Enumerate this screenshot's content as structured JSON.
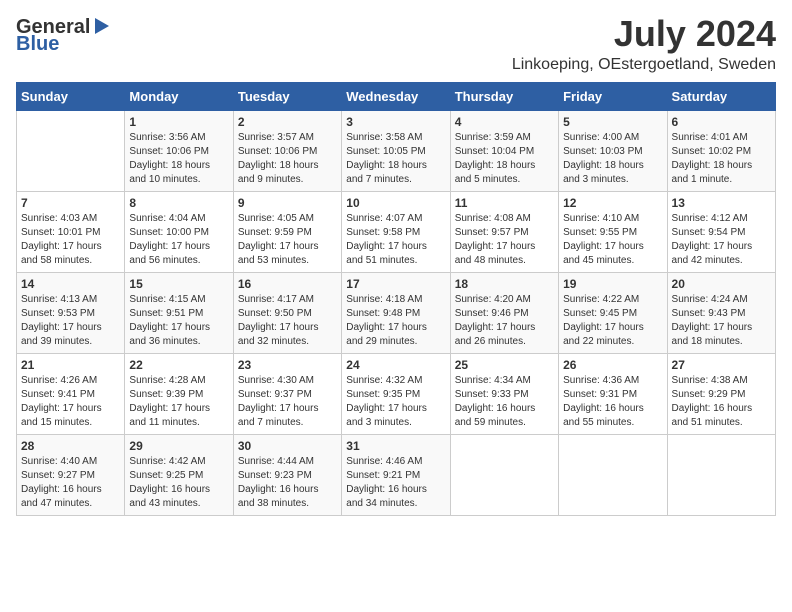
{
  "header": {
    "logo_general": "General",
    "logo_blue": "Blue",
    "month_year": "July 2024",
    "location": "Linkoeping, OEstergoetland, Sweden"
  },
  "days_of_week": [
    "Sunday",
    "Monday",
    "Tuesday",
    "Wednesday",
    "Thursday",
    "Friday",
    "Saturday"
  ],
  "weeks": [
    [
      {
        "day": "",
        "sunrise": "",
        "sunset": "",
        "daylight": ""
      },
      {
        "day": "1",
        "sunrise": "Sunrise: 3:56 AM",
        "sunset": "Sunset: 10:06 PM",
        "daylight": "Daylight: 18 hours and 10 minutes."
      },
      {
        "day": "2",
        "sunrise": "Sunrise: 3:57 AM",
        "sunset": "Sunset: 10:06 PM",
        "daylight": "Daylight: 18 hours and 9 minutes."
      },
      {
        "day": "3",
        "sunrise": "Sunrise: 3:58 AM",
        "sunset": "Sunset: 10:05 PM",
        "daylight": "Daylight: 18 hours and 7 minutes."
      },
      {
        "day": "4",
        "sunrise": "Sunrise: 3:59 AM",
        "sunset": "Sunset: 10:04 PM",
        "daylight": "Daylight: 18 hours and 5 minutes."
      },
      {
        "day": "5",
        "sunrise": "Sunrise: 4:00 AM",
        "sunset": "Sunset: 10:03 PM",
        "daylight": "Daylight: 18 hours and 3 minutes."
      },
      {
        "day": "6",
        "sunrise": "Sunrise: 4:01 AM",
        "sunset": "Sunset: 10:02 PM",
        "daylight": "Daylight: 18 hours and 1 minute."
      }
    ],
    [
      {
        "day": "7",
        "sunrise": "Sunrise: 4:03 AM",
        "sunset": "Sunset: 10:01 PM",
        "daylight": "Daylight: 17 hours and 58 minutes."
      },
      {
        "day": "8",
        "sunrise": "Sunrise: 4:04 AM",
        "sunset": "Sunset: 10:00 PM",
        "daylight": "Daylight: 17 hours and 56 minutes."
      },
      {
        "day": "9",
        "sunrise": "Sunrise: 4:05 AM",
        "sunset": "Sunset: 9:59 PM",
        "daylight": "Daylight: 17 hours and 53 minutes."
      },
      {
        "day": "10",
        "sunrise": "Sunrise: 4:07 AM",
        "sunset": "Sunset: 9:58 PM",
        "daylight": "Daylight: 17 hours and 51 minutes."
      },
      {
        "day": "11",
        "sunrise": "Sunrise: 4:08 AM",
        "sunset": "Sunset: 9:57 PM",
        "daylight": "Daylight: 17 hours and 48 minutes."
      },
      {
        "day": "12",
        "sunrise": "Sunrise: 4:10 AM",
        "sunset": "Sunset: 9:55 PM",
        "daylight": "Daylight: 17 hours and 45 minutes."
      },
      {
        "day": "13",
        "sunrise": "Sunrise: 4:12 AM",
        "sunset": "Sunset: 9:54 PM",
        "daylight": "Daylight: 17 hours and 42 minutes."
      }
    ],
    [
      {
        "day": "14",
        "sunrise": "Sunrise: 4:13 AM",
        "sunset": "Sunset: 9:53 PM",
        "daylight": "Daylight: 17 hours and 39 minutes."
      },
      {
        "day": "15",
        "sunrise": "Sunrise: 4:15 AM",
        "sunset": "Sunset: 9:51 PM",
        "daylight": "Daylight: 17 hours and 36 minutes."
      },
      {
        "day": "16",
        "sunrise": "Sunrise: 4:17 AM",
        "sunset": "Sunset: 9:50 PM",
        "daylight": "Daylight: 17 hours and 32 minutes."
      },
      {
        "day": "17",
        "sunrise": "Sunrise: 4:18 AM",
        "sunset": "Sunset: 9:48 PM",
        "daylight": "Daylight: 17 hours and 29 minutes."
      },
      {
        "day": "18",
        "sunrise": "Sunrise: 4:20 AM",
        "sunset": "Sunset: 9:46 PM",
        "daylight": "Daylight: 17 hours and 26 minutes."
      },
      {
        "day": "19",
        "sunrise": "Sunrise: 4:22 AM",
        "sunset": "Sunset: 9:45 PM",
        "daylight": "Daylight: 17 hours and 22 minutes."
      },
      {
        "day": "20",
        "sunrise": "Sunrise: 4:24 AM",
        "sunset": "Sunset: 9:43 PM",
        "daylight": "Daylight: 17 hours and 18 minutes."
      }
    ],
    [
      {
        "day": "21",
        "sunrise": "Sunrise: 4:26 AM",
        "sunset": "Sunset: 9:41 PM",
        "daylight": "Daylight: 17 hours and 15 minutes."
      },
      {
        "day": "22",
        "sunrise": "Sunrise: 4:28 AM",
        "sunset": "Sunset: 9:39 PM",
        "daylight": "Daylight: 17 hours and 11 minutes."
      },
      {
        "day": "23",
        "sunrise": "Sunrise: 4:30 AM",
        "sunset": "Sunset: 9:37 PM",
        "daylight": "Daylight: 17 hours and 7 minutes."
      },
      {
        "day": "24",
        "sunrise": "Sunrise: 4:32 AM",
        "sunset": "Sunset: 9:35 PM",
        "daylight": "Daylight: 17 hours and 3 minutes."
      },
      {
        "day": "25",
        "sunrise": "Sunrise: 4:34 AM",
        "sunset": "Sunset: 9:33 PM",
        "daylight": "Daylight: 16 hours and 59 minutes."
      },
      {
        "day": "26",
        "sunrise": "Sunrise: 4:36 AM",
        "sunset": "Sunset: 9:31 PM",
        "daylight": "Daylight: 16 hours and 55 minutes."
      },
      {
        "day": "27",
        "sunrise": "Sunrise: 4:38 AM",
        "sunset": "Sunset: 9:29 PM",
        "daylight": "Daylight: 16 hours and 51 minutes."
      }
    ],
    [
      {
        "day": "28",
        "sunrise": "Sunrise: 4:40 AM",
        "sunset": "Sunset: 9:27 PM",
        "daylight": "Daylight: 16 hours and 47 minutes."
      },
      {
        "day": "29",
        "sunrise": "Sunrise: 4:42 AM",
        "sunset": "Sunset: 9:25 PM",
        "daylight": "Daylight: 16 hours and 43 minutes."
      },
      {
        "day": "30",
        "sunrise": "Sunrise: 4:44 AM",
        "sunset": "Sunset: 9:23 PM",
        "daylight": "Daylight: 16 hours and 38 minutes."
      },
      {
        "day": "31",
        "sunrise": "Sunrise: 4:46 AM",
        "sunset": "Sunset: 9:21 PM",
        "daylight": "Daylight: 16 hours and 34 minutes."
      },
      {
        "day": "",
        "sunrise": "",
        "sunset": "",
        "daylight": ""
      },
      {
        "day": "",
        "sunrise": "",
        "sunset": "",
        "daylight": ""
      },
      {
        "day": "",
        "sunrise": "",
        "sunset": "",
        "daylight": ""
      }
    ]
  ]
}
